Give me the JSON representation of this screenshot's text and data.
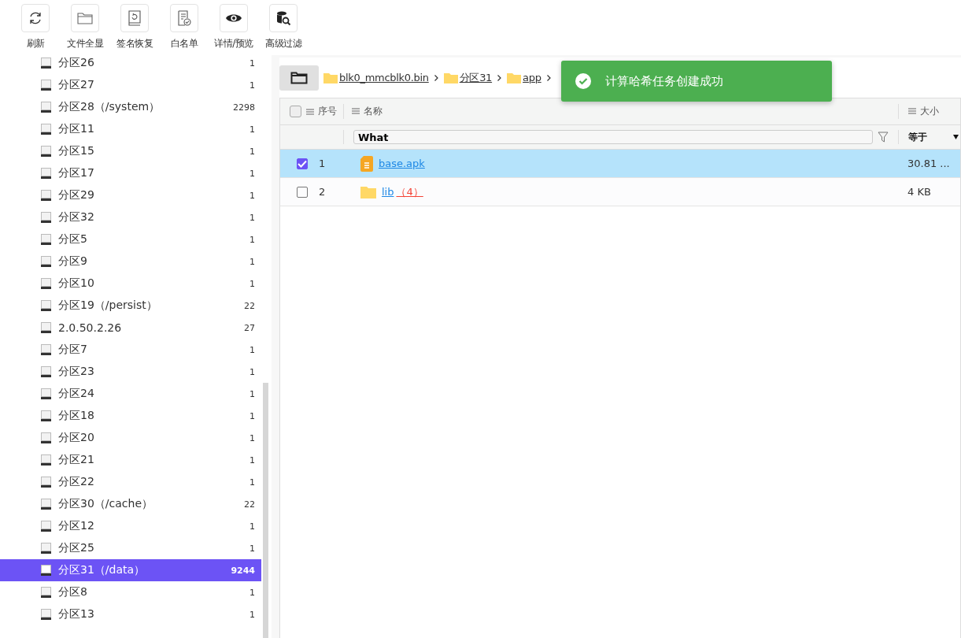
{
  "toolbar": [
    {
      "label": "刷新",
      "kind": "refresh"
    },
    {
      "label": "文件全显",
      "kind": "folder"
    },
    {
      "label": "签名恢复",
      "kind": "restore"
    },
    {
      "label": "白名单",
      "kind": "whitelist"
    },
    {
      "label": "详情/预览",
      "kind": "eye"
    },
    {
      "label": "高级过滤",
      "kind": "dbsearch"
    }
  ],
  "sidebar": {
    "items": [
      {
        "label": "分区26",
        "count": "1",
        "selected": false
      },
      {
        "label": "分区27",
        "count": "1",
        "selected": false
      },
      {
        "label": "分区28（/system）",
        "count": "2298",
        "selected": false
      },
      {
        "label": "分区11",
        "count": "1",
        "selected": false
      },
      {
        "label": "分区15",
        "count": "1",
        "selected": false
      },
      {
        "label": "分区17",
        "count": "1",
        "selected": false
      },
      {
        "label": "分区29",
        "count": "1",
        "selected": false
      },
      {
        "label": "分区32",
        "count": "1",
        "selected": false
      },
      {
        "label": "分区5",
        "count": "1",
        "selected": false
      },
      {
        "label": "分区9",
        "count": "1",
        "selected": false
      },
      {
        "label": "分区10",
        "count": "1",
        "selected": false
      },
      {
        "label": "分区19（/persist）",
        "count": "22",
        "selected": false
      },
      {
        "label": "2.0.50.2.26",
        "count": "27",
        "selected": false
      },
      {
        "label": "分区7",
        "count": "1",
        "selected": false
      },
      {
        "label": "分区23",
        "count": "1",
        "selected": false
      },
      {
        "label": "分区24",
        "count": "1",
        "selected": false
      },
      {
        "label": "分区18",
        "count": "1",
        "selected": false
      },
      {
        "label": "分区20",
        "count": "1",
        "selected": false
      },
      {
        "label": "分区21",
        "count": "1",
        "selected": false
      },
      {
        "label": "分区22",
        "count": "1",
        "selected": false
      },
      {
        "label": "分区30（/cache）",
        "count": "22",
        "selected": false
      },
      {
        "label": "分区12",
        "count": "1",
        "selected": false
      },
      {
        "label": "分区25",
        "count": "1",
        "selected": false
      },
      {
        "label": "分区31（/data）",
        "count": "9244",
        "selected": true
      },
      {
        "label": "分区8",
        "count": "1",
        "selected": false
      },
      {
        "label": "分区13",
        "count": "1",
        "selected": false
      }
    ]
  },
  "breadcrumb": [
    "blk0_mmcblk0.bin",
    "分区31",
    "app"
  ],
  "table": {
    "all_selected": false,
    "columns": [
      "序号",
      "名称",
      "大小"
    ],
    "filter": {
      "value": "What",
      "operator": "等于"
    },
    "rows": [
      {
        "index": "1",
        "name": "base.apk",
        "kind": "file",
        "count": "",
        "size": "30.81 ...",
        "selected": true
      },
      {
        "index": "2",
        "name": "lib",
        "kind": "folder",
        "count": "（4）",
        "size": "4 KB",
        "selected": false
      }
    ]
  },
  "toast": {
    "message": "计算哈希任务创建成功"
  }
}
